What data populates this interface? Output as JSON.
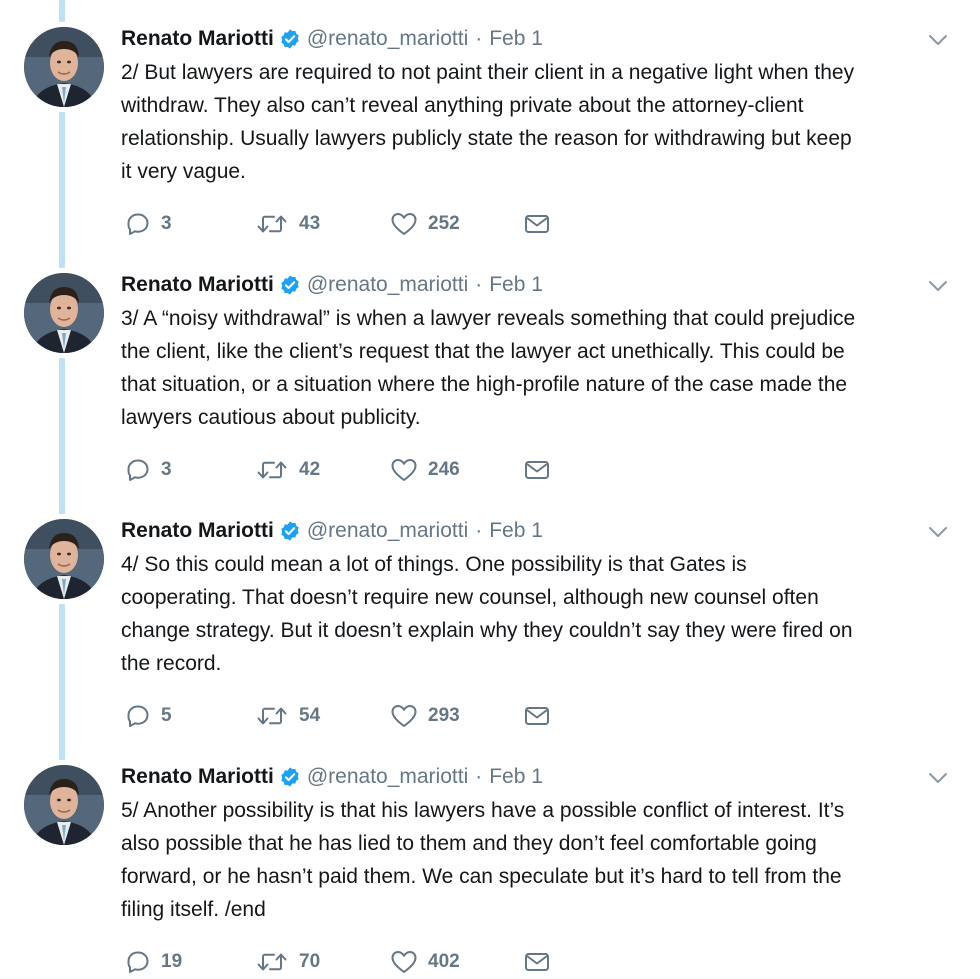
{
  "tweets": [
    {
      "name": "Renato Mariotti",
      "handle": "@renato_mariotti",
      "separator": "·",
      "date": "Feb 1",
      "text": "2/ But lawyers are required to not paint their client in a negative light when they\nwithdraw. They also can’t reveal anything private about the attorney-client\nrelationship. Usually lawyers publicly state the reason for withdrawing but keep\nit very vague.",
      "replies": "3",
      "retweets": "43",
      "likes": "252"
    },
    {
      "name": "Renato Mariotti",
      "handle": "@renato_mariotti",
      "separator": "·",
      "date": "Feb 1",
      "text": "3/ A “noisy withdrawal” is when a lawyer reveals something that could prejudice\nthe client, like the client’s request that the lawyer act unethically. This could be\nthat situation, or a situation where the high-profile nature of the case made the\nlawyers cautious about publicity.",
      "replies": "3",
      "retweets": "42",
      "likes": "246"
    },
    {
      "name": "Renato Mariotti",
      "handle": "@renato_mariotti",
      "separator": "·",
      "date": "Feb 1",
      "text": "4/ So this could mean a lot of things. One possibility is that Gates is\ncooperating. That doesn’t require new counsel, although new counsel often\nchange strategy. But it doesn’t explain why they couldn’t say they were fired on\nthe record.",
      "replies": "5",
      "retweets": "54",
      "likes": "293"
    },
    {
      "name": "Renato Mariotti",
      "handle": "@renato_mariotti",
      "separator": "·",
      "date": "Feb 1",
      "text": "5/ Another possibility is that his lawyers have a possible conflict of interest. It’s\nalso possible that he has lied to them and they don’t feel comfortable going\nforward, or he hasn’t paid them. We can speculate but it’s hard to tell from the\nfiling itself. /end",
      "replies": "19",
      "retweets": "70",
      "likes": "402"
    }
  ],
  "icons": {
    "verified": "verified-badge-icon",
    "caret": "chevron-down-icon",
    "reply": "reply-icon",
    "retweet": "retweet-icon",
    "like": "heart-icon",
    "message": "envelope-icon"
  },
  "colors": {
    "verified": "#1da1f2",
    "thread_line": "#bfe1f7",
    "muted": "#657786",
    "text": "#14171a"
  }
}
